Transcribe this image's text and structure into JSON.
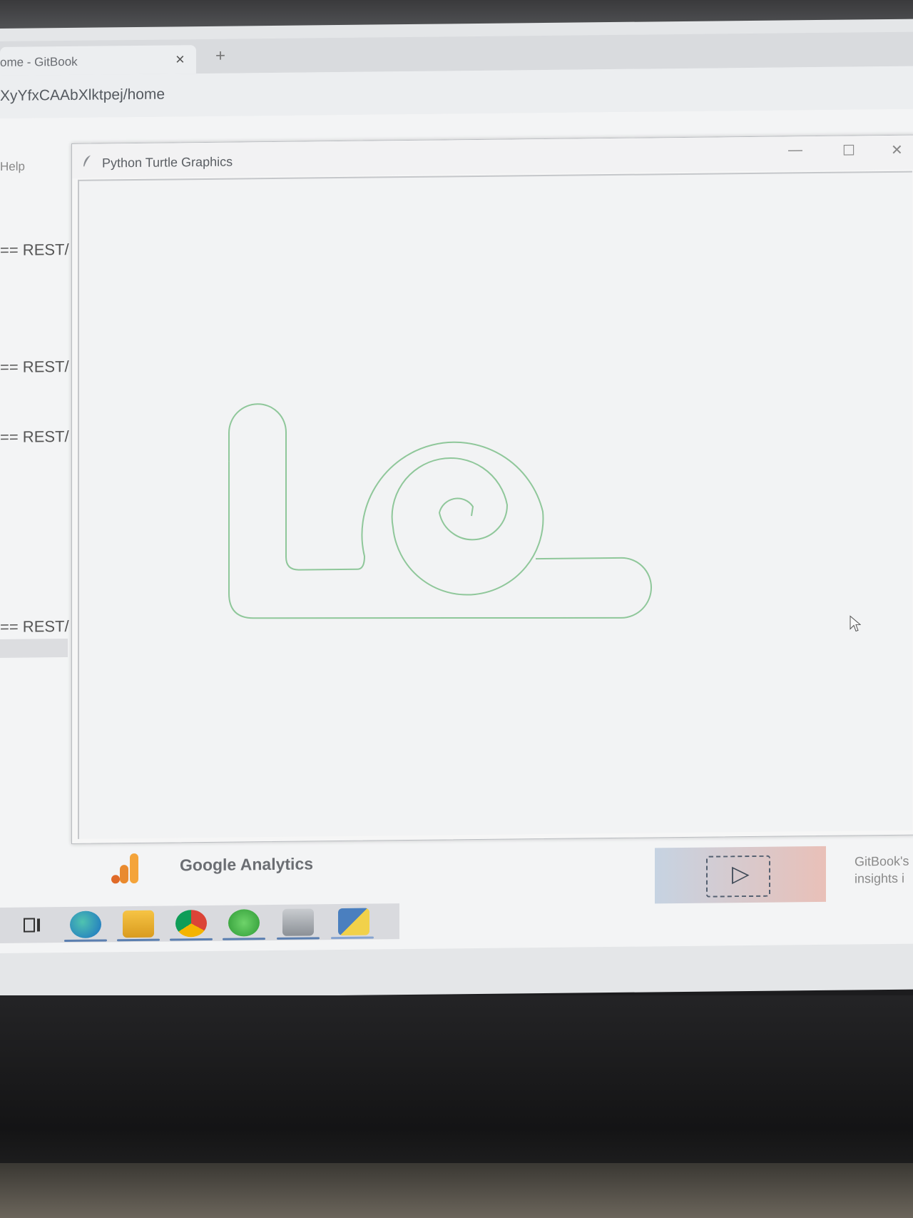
{
  "browser": {
    "tab_title": "ome - GitBook",
    "tab_close": "×",
    "new_tab": "+",
    "url": "XyYfxCAAbXlktpej/home"
  },
  "shell": {
    "menu_help": "Help",
    "restart_lines": [
      "== REST/",
      "== REST/",
      "== REST/",
      "== REST/"
    ]
  },
  "turtle_window": {
    "title": "Python Turtle Graphics",
    "minimize": "—",
    "maximize": "☐",
    "close": "✕",
    "pen_color": "#8fc79a"
  },
  "webpage": {
    "google_analytics": "Google Analytics",
    "promo_lines": [
      "GitBook's",
      "insights i"
    ]
  },
  "taskbar": {
    "icons": [
      "task-view-icon",
      "edge-icon",
      "file-explorer-icon",
      "chrome-icon",
      "wechat-icon",
      "app-icon",
      "python-icon"
    ]
  }
}
